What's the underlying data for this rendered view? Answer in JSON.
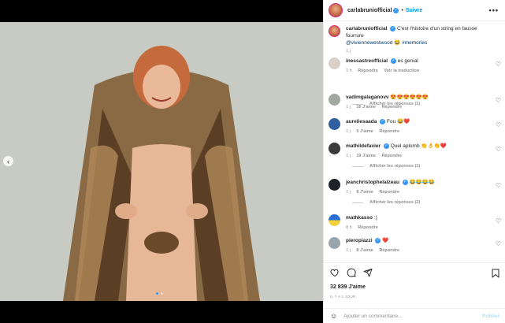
{
  "post_header": {
    "username": "carlabruniofficial",
    "separator": "•",
    "follow_label": "Suivre",
    "more_label": "•••"
  },
  "caption": {
    "username": "carlabruniofficial",
    "text": "C'est l'histoire d'un string en fausse fourrure",
    "mention": "@viviennewestwood",
    "emoji": "😂",
    "hashtag": "#memories",
    "time": "1 j"
  },
  "comments": [
    {
      "username": "inessastreofficial",
      "text": "es genial",
      "time": "1 h",
      "reply_label": "Répondre",
      "translate_label": "Voir la traduction",
      "replies_label": "Afficher les réponses (1)"
    },
    {
      "username": "vadimgalaganovv",
      "text": "😍😍😍😍😍😍",
      "time": "1 j",
      "likes": "16 J'aime",
      "reply_label": "Répondre"
    },
    {
      "username": "aureliesaada",
      "text": "Fou 😂❤️",
      "time": "1 j",
      "likes": "5 J'aime",
      "reply_label": "Répondre"
    },
    {
      "username": "mathildefavier",
      "text": "Quel aplomb 👏👌👏❤️",
      "time": "1 j",
      "likes": "19 J'aime",
      "reply_label": "Répondre",
      "replies_label": "Afficher les réponses (1)"
    },
    {
      "username": "jeanchristophelaizeau",
      "text": "😂😂😂😂",
      "time": "1 j",
      "likes": "8 J'aime",
      "reply_label": "Répondre",
      "replies_label": "Afficher les réponses (2)"
    },
    {
      "username": "mathkasso",
      "text": ":)",
      "time": "8 h",
      "reply_label": "Répondre"
    },
    {
      "username": "pieropiazzi",
      "text": "❤️",
      "time": "1 j",
      "likes": "8 J'aime",
      "reply_label": "Répondre"
    }
  ],
  "likes_count": "32 839 J'aime",
  "post_date": "IL Y A 1 JOUR",
  "comment_input": {
    "placeholder": "Ajouter un commentaire...",
    "publish_label": "Publier"
  },
  "icons": [
    "chevron-left-icon",
    "more-icon",
    "verified-icon",
    "heart-icon",
    "comment-icon",
    "share-icon",
    "bookmark-icon",
    "smiley-icon"
  ],
  "colors": {
    "accent": "#0095f6",
    "verified": "#3897f0",
    "muted": "#8e8e8e"
  }
}
